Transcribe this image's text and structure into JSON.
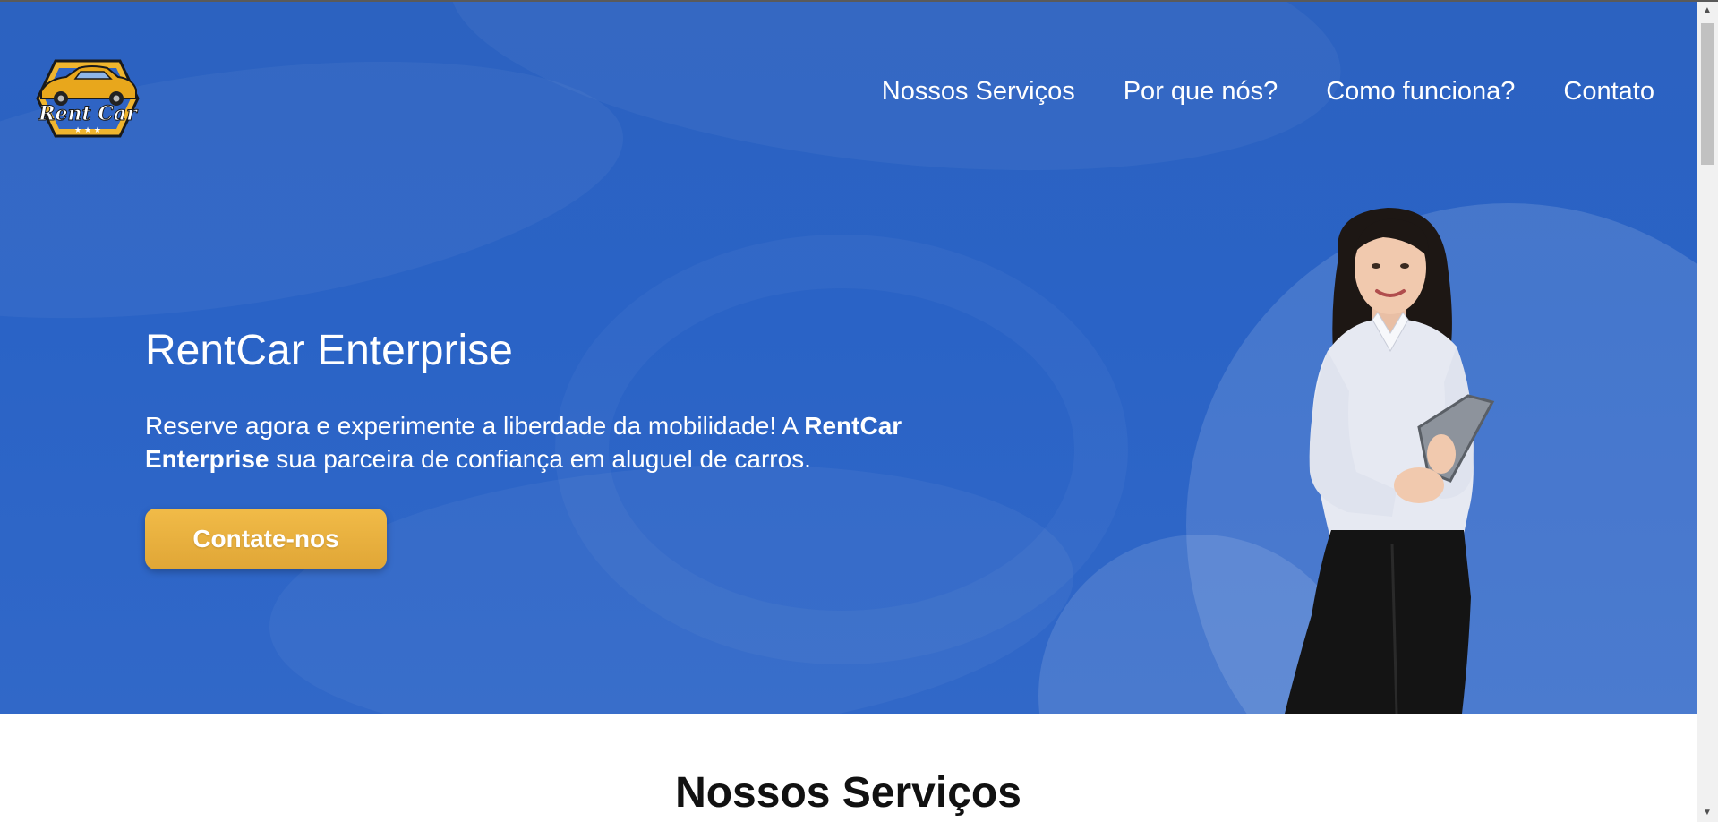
{
  "header": {
    "logo_alt": "Rent Car",
    "logo_text": "Rent Car",
    "nav": [
      {
        "label": "Nossos Serviços"
      },
      {
        "label": "Por que nós?"
      },
      {
        "label": "Como funciona?"
      },
      {
        "label": "Contato"
      }
    ]
  },
  "hero": {
    "title": "RentCar Enterprise",
    "text_part1": "Reserve agora e experimente a liberdade da mobilidade! A ",
    "text_bold": "RentCar Enterprise",
    "text_part2": " sua parceira de confiança em aluguel de carros.",
    "cta_label": "Contate-nos"
  },
  "services": {
    "title": "Nossos Serviços"
  },
  "colors": {
    "hero_blue": "#2a63c6",
    "cta_gold": "#e8b03d",
    "text_white": "#ffffff"
  },
  "icons": {
    "logo": "car-logo-icon",
    "scroll_up": "arrow-up-icon",
    "scroll_down": "arrow-down-icon"
  }
}
